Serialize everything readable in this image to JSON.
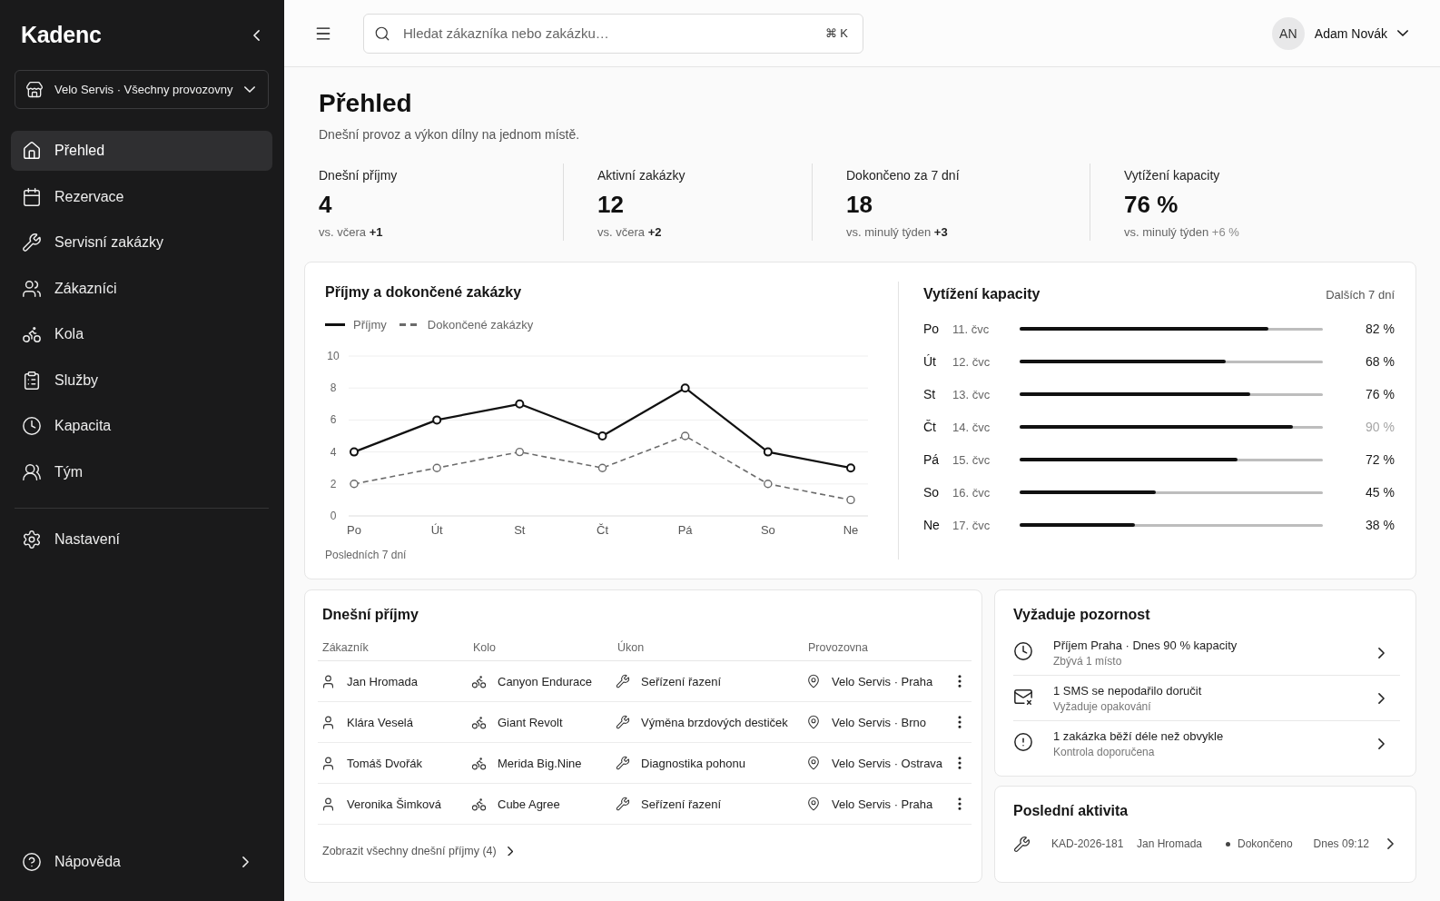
{
  "sidebar": {
    "logo": "Kadenc",
    "workspace": {
      "label": "Velo Servis · Všechny provozovny"
    },
    "items": [
      {
        "label": "Přehled",
        "kind": "home",
        "selected": true
      },
      {
        "label": "Rezervace",
        "kind": "calendar",
        "selected": false
      },
      {
        "label": "Servisní zakázky",
        "kind": "wrench",
        "selected": false
      },
      {
        "label": "Zákazníci",
        "kind": "users",
        "selected": false
      },
      {
        "label": "Kola",
        "kind": "bike",
        "selected": false
      },
      {
        "label": "Služby",
        "kind": "clipboard",
        "selected": false
      },
      {
        "label": "Kapacita",
        "kind": "clock",
        "selected": false
      },
      {
        "label": "Tým",
        "kind": "team",
        "selected": false
      }
    ],
    "settings": {
      "label": "Nastavení",
      "kind": "settings",
      "selected": false
    },
    "help": {
      "label": "Nápověda",
      "kind": "help"
    }
  },
  "header": {
    "search": {
      "placeholder": "Hledat zákazníka nebo zakázku…",
      "shortcut": "⌘ K"
    },
    "user": {
      "initials": "AN",
      "name": "Adam Novák"
    }
  },
  "page": {
    "title": "Přehled",
    "subtitle": "Dnešní provoz a výkon dílny na jednom místě."
  },
  "kpis": [
    {
      "label": "Dnešní příjmy",
      "value": "4",
      "comparison": "vs. včera",
      "delta": "+1",
      "muted": false
    },
    {
      "label": "Aktivní zakázky",
      "value": "12",
      "comparison": "vs. včera",
      "delta": "+2",
      "muted": false
    },
    {
      "label": "Dokončeno za 7 dní",
      "value": "18",
      "comparison": "vs. minulý týden",
      "delta": "+3",
      "muted": false
    },
    {
      "label": "Vytížení kapacity",
      "value": "76 %",
      "comparison": "vs. minulý týden",
      "delta": "+6 %",
      "muted": true
    }
  ],
  "revenue_chart": {
    "chart_data": {
      "type": "line",
      "title": "Příjmy a dokončené zakázky",
      "categories": [
        "Po",
        "Út",
        "St",
        "Čt",
        "Pá",
        "So",
        "Ne"
      ],
      "series": [
        {
          "name": "Příjmy",
          "color": "#111111",
          "line_style": "solid",
          "marker": "circle",
          "values": [
            4,
            6,
            7,
            5,
            8,
            4,
            3
          ]
        },
        {
          "name": "Dokončené zakázky",
          "color": "#6b6b6b",
          "line_style": "dashed",
          "marker": "circle",
          "values": [
            2,
            3,
            4,
            3,
            5,
            2,
            1
          ]
        }
      ],
      "ylim": [
        0,
        10
      ],
      "yticks": [
        0,
        2,
        4,
        6,
        8,
        10
      ],
      "grid": true,
      "legend": "top"
    },
    "caption": "Posledních 7 dní"
  },
  "capacity": {
    "title": "Vytížení kapacity",
    "range": "Dalších 7 dní",
    "days": [
      {
        "day": "Po",
        "date": "11. čvc",
        "level": 0.82,
        "reading": "82 %",
        "muted": false
      },
      {
        "day": "Út",
        "date": "12. čvc",
        "level": 0.68,
        "reading": "68 %",
        "muted": false
      },
      {
        "day": "St",
        "date": "13. čvc",
        "level": 0.76,
        "reading": "76 %",
        "muted": false
      },
      {
        "day": "Čt",
        "date": "14. čvc",
        "level": 0.9,
        "reading": "90 %",
        "muted": true
      },
      {
        "day": "Pá",
        "date": "15. čvc",
        "level": 0.72,
        "reading": "72 %",
        "muted": false
      },
      {
        "day": "So",
        "date": "16. čvc",
        "level": 0.45,
        "reading": "45 %",
        "muted": false
      },
      {
        "day": "Ne",
        "date": "17. čvc",
        "level": 0.38,
        "reading": "38 %",
        "muted": false
      }
    ]
  },
  "intakes": {
    "title": "Dnešní příjmy",
    "columns": [
      "Zákazník",
      "Kolo",
      "Úkon",
      "Provozovna"
    ],
    "rows": [
      {
        "customer": "Jan Hromada",
        "bike": "Canyon Endurace",
        "service": "Seřízení řazení",
        "location": "Velo Servis · Praha"
      },
      {
        "customer": "Klára Veselá",
        "bike": "Giant Revolt",
        "service": "Výměna brzdových destiček",
        "location": "Velo Servis · Brno"
      },
      {
        "customer": "Tomáš Dvořák",
        "bike": "Merida Big.Nine",
        "service": "Diagnostika pohonu",
        "location": "Velo Servis · Ostrava"
      },
      {
        "customer": "Veronika Šimková",
        "bike": "Cube Agree",
        "service": "Seřízení řazení",
        "location": "Velo Servis · Praha"
      }
    ],
    "footer_link": "Zobrazit všechny dnešní příjmy (4)"
  },
  "attention": {
    "title": "Vyžaduje pozornost",
    "items": [
      {
        "kind": "capacity",
        "title": "Příjem Praha · Dnes 90 % kapacity",
        "subtitle": "Zbývá 1 místo"
      },
      {
        "kind": "message",
        "title": "1 SMS se nepodařilo doručit",
        "subtitle": "Vyžaduje opakování"
      },
      {
        "kind": "warning",
        "title": "1 zakázka běží déle než obvykle",
        "subtitle": "Kontrola doporučena"
      }
    ]
  },
  "activity": {
    "title": "Poslední aktivita",
    "items": [
      {
        "code": "KAD-2026-181",
        "customer": "Jan Hromada",
        "status": "Dokončeno",
        "time": "Dnes 09:12"
      }
    ]
  }
}
